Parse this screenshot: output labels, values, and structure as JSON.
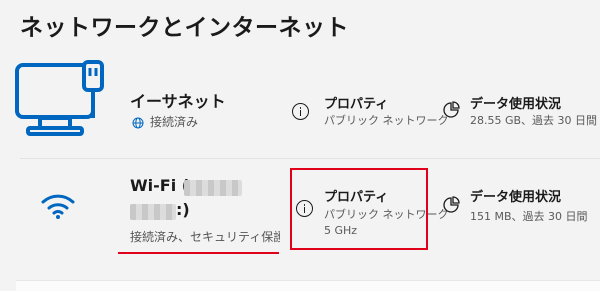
{
  "page": {
    "title": "ネットワークとインターネット"
  },
  "ethernet": {
    "name": "イーサネット",
    "status": "接続済み",
    "properties": {
      "title": "プロパティ",
      "subtitle": "パブリック ネットワーク"
    },
    "data_usage": {
      "title": "データ使用状況",
      "subtitle": "28.55 GB、過去 30 日間"
    }
  },
  "wifi": {
    "name_prefix": "Wi-Fi (",
    "name_suffix": ":)",
    "status": "接続済み、セキュリティ保護さ",
    "properties": {
      "title": "プロパティ",
      "subtitle": "パブリック ネットワーク",
      "band": "5 GHz"
    },
    "data_usage": {
      "title": "データ使用状況",
      "subtitle": "151 MB、過去 30 日間"
    }
  },
  "icons": {
    "ethernet": "monitor-ethernet-icon",
    "globe": "globe-icon",
    "wifi": "wifi-icon",
    "info": "info-icon",
    "pie": "pie-chart-icon"
  },
  "colors": {
    "accent": "#0067c0",
    "highlight": "#e0001a"
  }
}
